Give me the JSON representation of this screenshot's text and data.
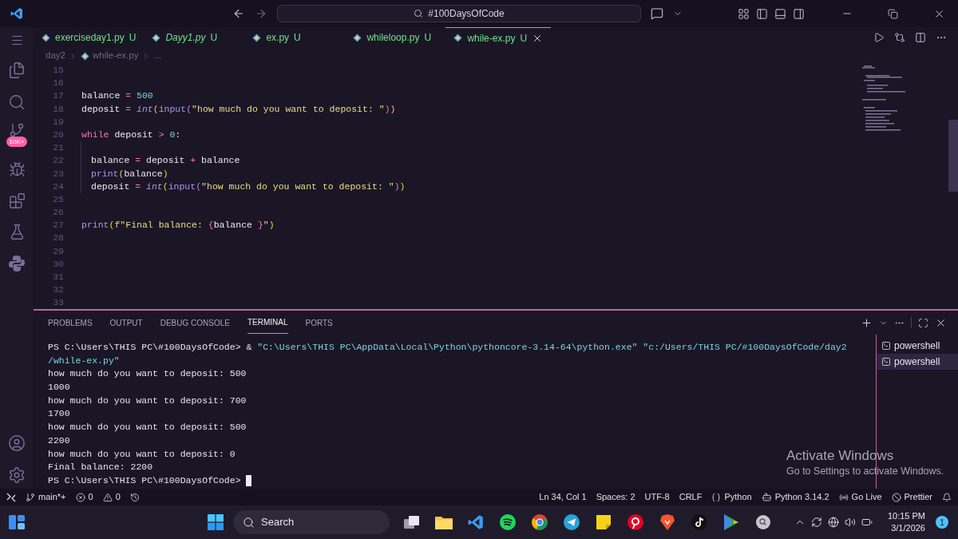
{
  "title_bar": {
    "search": "#100DaysOfCode"
  },
  "tabs": [
    {
      "label": "exerciseday1.py",
      "status": "U",
      "selected": false,
      "preview": false
    },
    {
      "label": "Dayy1.py",
      "status": "U",
      "selected": false,
      "preview": true
    },
    {
      "label": "ex.py",
      "status": "U",
      "selected": false,
      "preview": false
    },
    {
      "label": "whileloop.py",
      "status": "U",
      "selected": false,
      "preview": false
    },
    {
      "label": "while-ex.py",
      "status": "U",
      "selected": true,
      "preview": false
    }
  ],
  "breadcrumb": [
    "day2",
    "while-ex.py",
    "..."
  ],
  "activity_badge": "10K+",
  "code_lines": [
    {
      "number": "15"
    },
    {
      "number": "16"
    },
    {
      "number": "17",
      "tokens": [
        {
          "text": "balance ",
          "kind": "var"
        },
        {
          "text": "= ",
          "kind": "op"
        },
        {
          "text": "500",
          "kind": "num"
        }
      ]
    },
    {
      "number": "18",
      "tokens": [
        {
          "text": "deposit ",
          "kind": "var"
        },
        {
          "text": "= ",
          "kind": "op"
        },
        {
          "text": "int",
          "kind": "type"
        },
        {
          "text": "(",
          "kind": "paren"
        },
        {
          "text": "input",
          "kind": "fn"
        },
        {
          "text": "(",
          "kind": "paren2"
        },
        {
          "text": "\"how much do you want to deposit: \"",
          "kind": "str"
        },
        {
          "text": ")",
          "kind": "paren2"
        },
        {
          "text": ")",
          "kind": "paren"
        }
      ]
    },
    {
      "number": "19"
    },
    {
      "number": "20",
      "tokens": [
        {
          "text": "while ",
          "kind": "kw"
        },
        {
          "text": "deposit ",
          "kind": "var"
        },
        {
          "text": "> ",
          "kind": "op"
        },
        {
          "text": "0",
          "kind": "num"
        },
        {
          "text": ":",
          "kind": "var"
        }
      ]
    },
    {
      "number": "21",
      "indented": true
    },
    {
      "number": "22",
      "indented": true,
      "tokens": [
        {
          "text": "balance ",
          "kind": "var"
        },
        {
          "text": "= ",
          "kind": "op"
        },
        {
          "text": "deposit ",
          "kind": "var"
        },
        {
          "text": "+ ",
          "kind": "op"
        },
        {
          "text": "balance",
          "kind": "var"
        }
      ]
    },
    {
      "number": "23",
      "indented": true,
      "tokens": [
        {
          "text": "print",
          "kind": "fn"
        },
        {
          "text": "(",
          "kind": "paren"
        },
        {
          "text": "balance",
          "kind": "var"
        },
        {
          "text": ")",
          "kind": "paren"
        }
      ]
    },
    {
      "number": "24",
      "indented": true,
      "tokens": [
        {
          "text": "deposit ",
          "kind": "var"
        },
        {
          "text": "= ",
          "kind": "op"
        },
        {
          "text": "int",
          "kind": "type"
        },
        {
          "text": "(",
          "kind": "paren"
        },
        {
          "text": "input",
          "kind": "fn"
        },
        {
          "text": "(",
          "kind": "paren2"
        },
        {
          "text": "\"how much do you want to deposit: \"",
          "kind": "str"
        },
        {
          "text": ")",
          "kind": "paren2"
        },
        {
          "text": ")",
          "kind": "paren"
        }
      ]
    },
    {
      "number": "25"
    },
    {
      "number": "26"
    },
    {
      "number": "27",
      "tokens": [
        {
          "text": "print",
          "kind": "fn"
        },
        {
          "text": "(",
          "kind": "paren"
        },
        {
          "text": "f\"Final balance: ",
          "kind": "str"
        },
        {
          "text": "{",
          "kind": "kw"
        },
        {
          "text": "balance ",
          "kind": "var"
        },
        {
          "text": "}",
          "kind": "kw"
        },
        {
          "text": "\"",
          "kind": "str"
        },
        {
          "text": ")",
          "kind": "paren"
        }
      ]
    },
    {
      "number": "28"
    },
    {
      "number": "29"
    },
    {
      "number": "30"
    },
    {
      "number": "31"
    },
    {
      "number": "32"
    },
    {
      "number": "33"
    }
  ],
  "panel_tabs": [
    {
      "label": "PROBLEMS",
      "selected": false
    },
    {
      "label": "OUTPUT",
      "selected": false
    },
    {
      "label": "DEBUG CONSOLE",
      "selected": false
    },
    {
      "label": "TERMINAL",
      "selected": true
    },
    {
      "label": "PORTS",
      "selected": false
    }
  ],
  "terminal_lines": [
    [
      {
        "text": "PS C:\\Users\\THIS PC\\#100DaysOfCode> & ",
        "kind": "plain"
      },
      {
        "text": "\"C:\\Users\\THIS PC\\AppData\\Local\\Python\\pythoncore-3.14-64\\python.exe\" \"c:/Users/THIS PC/#100DaysOfCode/day2",
        "kind": "string"
      }
    ],
    [
      {
        "text": "/while-ex.py\"",
        "kind": "string"
      }
    ],
    [
      {
        "text": "how much do you want to deposit: 500",
        "kind": "plain"
      }
    ],
    [
      {
        "text": "1000",
        "kind": "plain"
      }
    ],
    [
      {
        "text": "how much do you want to deposit: 700",
        "kind": "plain"
      }
    ],
    [
      {
        "text": "1700",
        "kind": "plain"
      }
    ],
    [
      {
        "text": "how much do you want to deposit: 500",
        "kind": "plain"
      }
    ],
    [
      {
        "text": "2200",
        "kind": "plain"
      }
    ],
    [
      {
        "text": "how much do you want to deposit: 0",
        "kind": "plain"
      }
    ],
    [
      {
        "text": "Final balance: 2200",
        "kind": "plain"
      }
    ],
    [
      {
        "text": "PS C:\\Users\\THIS PC\\#100DaysOfCode> ",
        "kind": "plain"
      }
    ]
  ],
  "terminals": [
    {
      "label": "powershell",
      "selected": false
    },
    {
      "label": "powershell",
      "selected": true
    }
  ],
  "os_notice": {
    "title": "Activate Windows",
    "text": "Go to Settings to activate Windows."
  },
  "status_bar": {
    "left": [
      {
        "kind": "branch",
        "label": "main*+"
      },
      {
        "kind": "errors",
        "label": "0"
      },
      {
        "kind": "warnings",
        "label": "0"
      }
    ],
    "right": [
      {
        "kind": "text",
        "label": "Ln 34, Col 1"
      },
      {
        "kind": "text",
        "label": "Spaces: 2"
      },
      {
        "kind": "text",
        "label": "UTF-8"
      },
      {
        "kind": "text",
        "label": "CRLF"
      },
      {
        "kind": "language",
        "label": "Python"
      },
      {
        "kind": "interpreter",
        "label": "Python 3.14.2"
      },
      {
        "kind": "live",
        "label": "Go Live"
      },
      {
        "kind": "formatter",
        "label": "Prettier"
      }
    ]
  },
  "taskbar": {
    "search": "Search",
    "time": "10:15 PM",
    "date": "3/1/2026",
    "notifications": "1"
  }
}
